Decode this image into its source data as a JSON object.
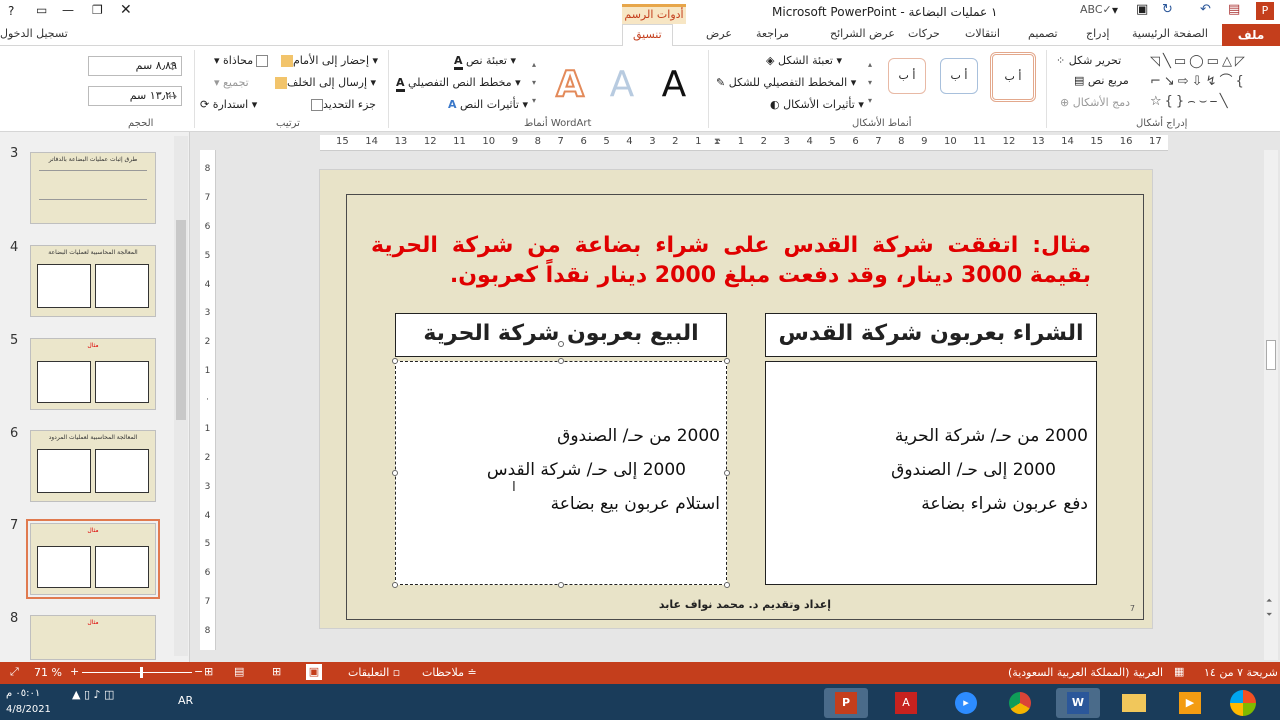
{
  "window": {
    "title": "١ عمليات البضاعة - Microsoft PowerPoint",
    "context_group": "أدوات الرسم",
    "sign_in": "تسجيل الدخول"
  },
  "tabs": {
    "file": "ملف",
    "home": "الصفحة الرئيسية",
    "insert": "إدراج",
    "design": "تصميم",
    "transitions": "انتقالات",
    "animations": "حركات",
    "slideshow": "عرض الشرائح",
    "review": "مراجعة",
    "view": "عرض",
    "format": "تنسيق"
  },
  "ribbon": {
    "insert_shapes": {
      "label": "إدراج أشكال",
      "edit_shape": "تحرير شكل",
      "text_box": "مربع نص",
      "merge_shapes": "دمج الأشكال"
    },
    "shape_styles": {
      "label": "أنماط الأشكال",
      "fill": "تعبئة الشكل",
      "outline": "المخطط التفصيلي للشكل",
      "effects": "تأثيرات الأشكال",
      "sample": "أ ب"
    },
    "wordart": {
      "label": "أنماط WordArt",
      "text_fill": "تعبئة نص",
      "text_outline": "مخطط النص التفصيلي",
      "text_effects": "تأثيرات النص",
      "letter": "A"
    },
    "arrange": {
      "label": "ترتيب",
      "bring_forward": "إحضار إلى الأمام",
      "send_backward": "إرسال إلى الخلف",
      "selection_pane": "جزء التحديد",
      "align": "محاذاة",
      "group": "تجميع",
      "rotate": "استدارة"
    },
    "size": {
      "label": "الحجم",
      "height": "٨٫٨٩ سم",
      "width": "١٣٫٢١ سم"
    }
  },
  "thumbnails": [
    {
      "num": "3",
      "title": "طرق إثبات عمليات البضاعة بالدفاتر"
    },
    {
      "num": "4",
      "title": "المعالجة المحاسبية لعمليات البضاعة"
    },
    {
      "num": "5",
      "title": "مثال"
    },
    {
      "num": "6",
      "title": "المعالجة المحاسبية لعمليات المردود"
    },
    {
      "num": "7",
      "title": "مثال"
    },
    {
      "num": "8",
      "title": "مثال"
    }
  ],
  "ruler": {
    "h_ticks": [
      "15",
      "14",
      "13",
      "12",
      "11",
      "10",
      "9",
      "8",
      "7",
      "6",
      "5",
      "4",
      "3",
      "2",
      "1",
      "",
      "1",
      "2",
      "3",
      "4",
      "5",
      "6",
      "7",
      "8",
      "9",
      "10",
      "11",
      "12",
      "13",
      "14",
      "15",
      "16",
      "17"
    ],
    "v_ticks": [
      "8",
      "7",
      "6",
      "5",
      "4",
      "3",
      "2",
      "1",
      "",
      "1",
      "2",
      "3",
      "4",
      "5",
      "6",
      "7",
      "8"
    ]
  },
  "slide": {
    "example": "مثال: اتفقت شركة القدس على شراء بضاعة من شركة الحرية بقيمة 3000 دينار، وقد دفعت مبلغ 2000 دينار نقداً كعربون.",
    "left_header": "البيع بعربون شركة الحرية",
    "right_header": "الشراء بعربون شركة القدس",
    "left_lines": [
      "2000 من حـ/ الصندوق",
      "2000 إلى حـ/ شركة القدس",
      "استلام عربون بيع بضاعة"
    ],
    "right_lines": [
      "2000 من حـ/ شركة الحرية",
      "2000 إلى حـ/ الصندوق",
      "دفع عربون شراء بضاعة"
    ],
    "footer": "إعداد وتقديم د. محمد نواف عابد",
    "page_num": "7"
  },
  "status": {
    "slide_info": "شريحة ٧ من ١٤",
    "language": "العربية (المملكة العربية السعودية)",
    "notes": "ملاحظات",
    "comments": "التعليقات",
    "zoom": "71 %"
  },
  "taskbar": {
    "lang": "AR",
    "time": "٠٥:٠١ م",
    "date": "4/8/2021"
  },
  "colors": {
    "accent": "#c43e1c",
    "slide_bg": "#e8e3c8",
    "example_text": "#e00000"
  }
}
